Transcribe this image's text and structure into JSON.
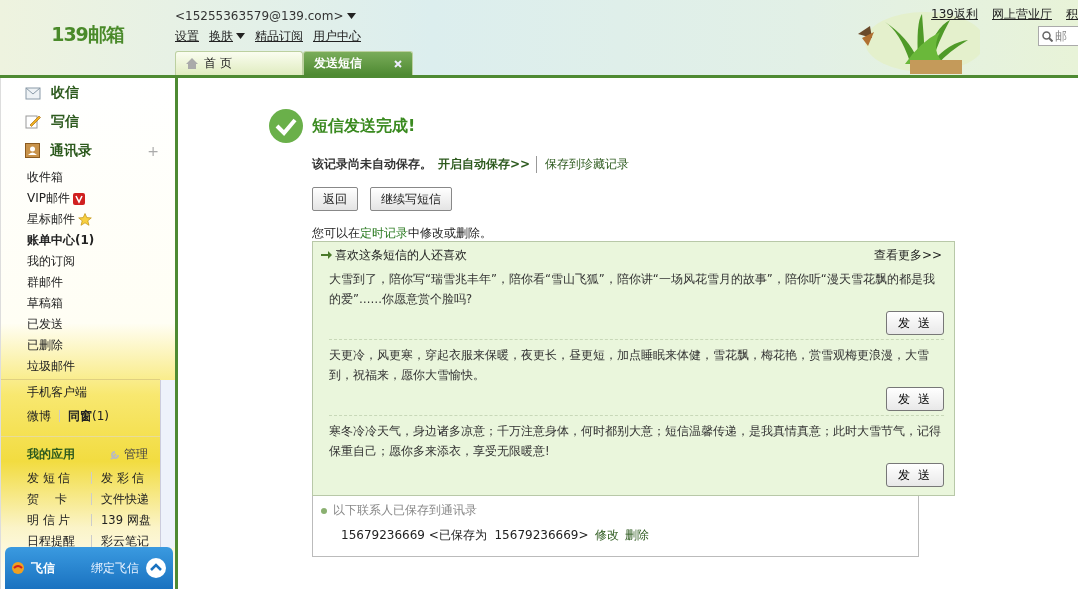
{
  "header": {
    "logo": "139邮箱",
    "account": "<15255363579@139.com>",
    "nav_links": [
      {
        "label": "设置",
        "dropdown": false
      },
      {
        "label": "换肤",
        "dropdown": true
      },
      {
        "label": "精品订阅",
        "dropdown": false
      },
      {
        "label": "用户中心",
        "dropdown": false
      }
    ],
    "top_links": [
      "139返利",
      "网上营业厅",
      "积"
    ],
    "search": {
      "placeholder": "邮"
    },
    "tabs": [
      {
        "label": "首 页",
        "selected": false,
        "closable": false
      },
      {
        "label": "发送短信",
        "selected": true,
        "closable": true
      }
    ]
  },
  "sidebar": {
    "main_items": [
      {
        "label": "收信",
        "kind": "inbox"
      },
      {
        "label": "写信",
        "kind": "compose"
      },
      {
        "label": "通讯录",
        "kind": "contacts"
      }
    ],
    "add": "+",
    "folders": [
      {
        "label": "收件箱",
        "kind": "plain",
        "bold": false
      },
      {
        "label": "VIP邮件",
        "kind": "vip",
        "bold": false
      },
      {
        "label": "星标邮件",
        "kind": "star",
        "bold": false
      },
      {
        "label": "账单中心(1)",
        "kind": "plain",
        "bold": true
      },
      {
        "label": "我的订阅",
        "kind": "plain",
        "bold": false
      },
      {
        "label": "群邮件",
        "kind": "plain",
        "bold": false
      },
      {
        "label": "草稿箱",
        "kind": "plain",
        "bold": false
      },
      {
        "label": "已发送",
        "kind": "plain",
        "bold": false
      },
      {
        "label": "已删除",
        "kind": "plain",
        "bold": false
      },
      {
        "label": "垃圾邮件",
        "kind": "plain",
        "bold": false
      }
    ],
    "mobile": "手机客户端",
    "weibo": "微博",
    "classmates": "同窗",
    "classmates_count": "(1)",
    "apps_title": "我的应用",
    "manage": "管理",
    "apps": [
      [
        "发 短 信",
        "发 彩 信"
      ],
      [
        "贺　 卡",
        "文件快递"
      ],
      [
        "明 信 片",
        "139 网盘"
      ],
      [
        "日程提醒",
        "彩云笔记"
      ]
    ],
    "fetion": {
      "label": "飞信",
      "bind": "绑定飞信"
    }
  },
  "main": {
    "title": "短信发送完成!",
    "notice": "该记录尚未自动保存。",
    "auto_save": "开启自动保存>>",
    "favorite": "保存到珍藏记录",
    "buttons": [
      "返回",
      "继续写短信"
    ],
    "info_before": "您可以在",
    "info_link": "定时记录",
    "info_after": "中修改或删除。",
    "recommend": {
      "title": "喜欢这条短信的人还喜欢",
      "more": "查看更多>>",
      "messages": [
        {
          "text": "大雪到了，陪你写“瑞雪兆丰年”，陪你看“雪山飞狐”，陪你讲“一场风花雪月的故事”，陪你听“漫天雪花飘的都是我的爱”……你愿意赏个脸吗?",
          "button": "发 送"
        },
        {
          "text": "天更冷，风更寒，穿起衣服来保暖，夜更长，昼更短，加点睡眠来体健，雪花飘，梅花艳，赏雪观梅更浪漫，大雪到，祝福来，愿你大雪愉快。",
          "button": "发 送"
        },
        {
          "text": "寒冬冷冷天气，身边诸多凉意；千万注意身体，何时都别大意；短信温馨传递，是我真情真意；此时大雪节气，记得保重自己；愿你多来添衣，享受无限暖意!",
          "button": "发 送"
        }
      ]
    },
    "saved": {
      "title": "以下联系人已保存到通讯录",
      "contacts": [
        {
          "text": "15679236669 <已保存为  15679236669>",
          "edit": "修改",
          "delete": "删除"
        }
      ]
    }
  }
}
